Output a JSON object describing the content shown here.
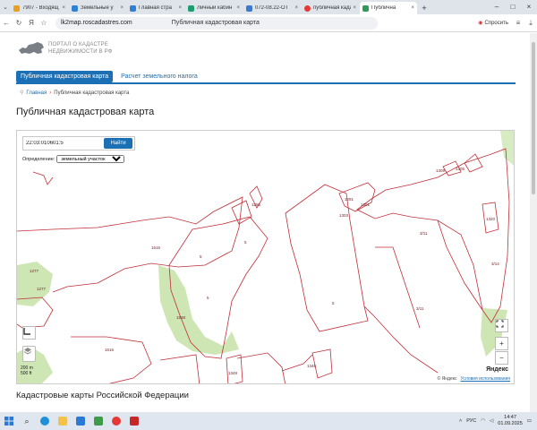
{
  "browser": {
    "tabs": [
      {
        "label": "7907 - Входящ",
        "color": "#e8a020"
      },
      {
        "label": "Земельные у",
        "color": "#2f7fd3"
      },
      {
        "label": "Главная стра",
        "color": "#2f7fd3"
      },
      {
        "label": "Личный кабин",
        "color": "#1b9e6f"
      },
      {
        "label": "072-08.22-ОТ",
        "color": "#3a7ad1"
      },
      {
        "label": "публичная када",
        "color": "#e53935"
      },
      {
        "label": "Публична",
        "color": "#2e9b58",
        "active": true
      }
    ],
    "url": "lk2map.roscadastres.com",
    "page_title": "Публичная кадастровая карта",
    "ask_label": "Спросить",
    "new_tab": "+"
  },
  "site": {
    "logo_line1": "ПОРТАЛ О КАДАСТРЕ",
    "logo_line2": "НЕДВИЖИМОСТИ В РФ",
    "menu": [
      {
        "label": "Публичная кадастровая карта",
        "active": true
      },
      {
        "label": "Расчет земельного налога",
        "active": false
      }
    ],
    "breadcrumb": {
      "home": "Главная",
      "sep": "›",
      "current": "Публичная кадастровая карта"
    },
    "page_heading": "Публичная кадастровая карта",
    "section_heading": "Кадастровые карты Российской Федерации"
  },
  "map": {
    "search_value": "22:03:010601:5",
    "search_button": "Найти",
    "define_label": "Определение:",
    "define_selected": "земельный участок",
    "scale_top": "200 m",
    "scale_bottom": "500 ft",
    "yandex_logo": "Яндекс",
    "copyright": "© Яндекс",
    "terms_link": "Условия использования",
    "zoom_in": "+",
    "zoom_out": "−",
    "parcel_labels": [
      "1616",
      "5",
      "5",
      "5",
      "5",
      "1538",
      "1616",
      "1277",
      "1277",
      "3/11",
      "3/11",
      "3/14",
      "1295",
      "1291",
      "1301",
      "1303",
      "1305",
      "1320",
      "1346",
      "1349",
      "1309"
    ]
  },
  "taskbar": {
    "lang": "РУС",
    "time": "14:47",
    "date": "01.09.2025"
  }
}
